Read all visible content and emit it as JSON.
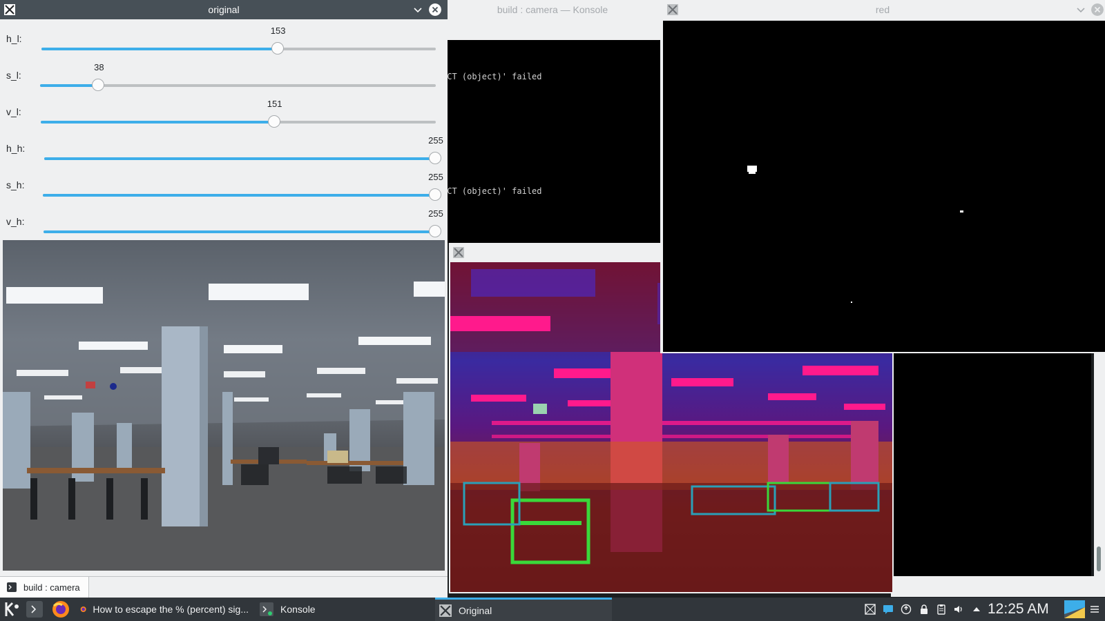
{
  "windows": {
    "original": {
      "title": "original",
      "sliders": [
        {
          "label": "h_l:",
          "value": "153",
          "fraction": 0.6
        },
        {
          "label": "s_l:",
          "value": "38",
          "fraction": 0.149
        },
        {
          "label": "v_l:",
          "value": "151",
          "fraction": 0.592
        },
        {
          "label": "h_h:",
          "value": "255",
          "fraction": 1.0
        },
        {
          "label": "s_h:",
          "value": "255",
          "fraction": 1.0
        },
        {
          "label": "v_h:",
          "value": "255",
          "fraction": 1.0
        }
      ]
    },
    "konsole": {
      "title": "build : camera — Konsole",
      "lines": [
        "ECT (object)' failed",
        "ECT (object)' failed"
      ],
      "tab_label": "build : camera"
    },
    "red": {
      "title": "red"
    },
    "hsv": {
      "title": ""
    }
  },
  "taskbar": {
    "items": [
      {
        "label": "How to escape the % (percent) sig...",
        "icon": "firefox-icon"
      },
      {
        "label": "Konsole",
        "icon": "konsole-icon"
      },
      {
        "label": "Original",
        "icon": "x-window-icon"
      }
    ],
    "clock": "12:25 AM"
  },
  "colors": {
    "accent": "#3daee9",
    "titlebar_active": "#475057",
    "titlebar_inactive": "#eff0f1",
    "panel": "#31363b"
  }
}
